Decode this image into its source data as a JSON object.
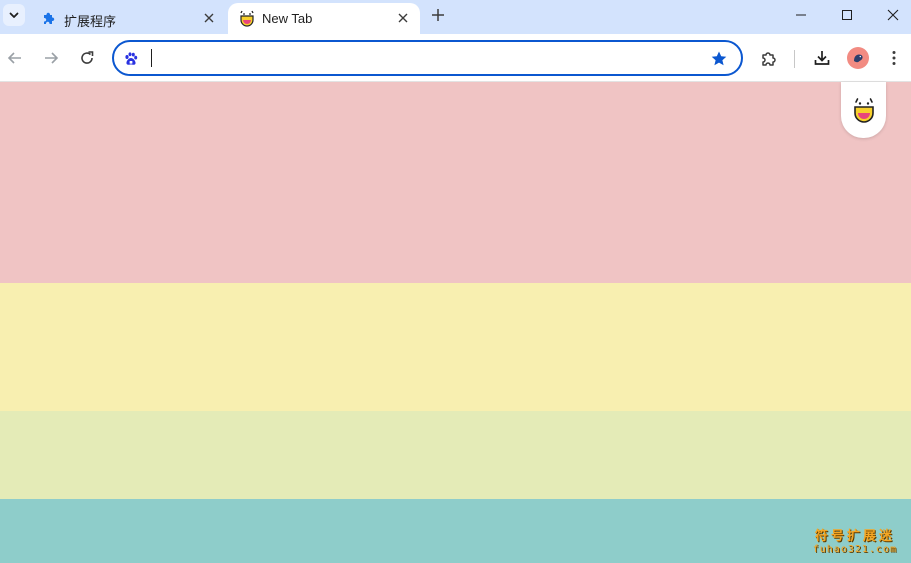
{
  "tabs": [
    {
      "label": "扩展程序",
      "icon": "puzzle-icon",
      "active": false
    },
    {
      "label": "New Tab",
      "icon": "smiley-logo-icon",
      "active": true
    }
  ],
  "toolbar": {
    "omnibox_value": "",
    "search_engine_icon": "baidu-paw-icon"
  },
  "page": {
    "bands": [
      {
        "color": "#f0c4c4"
      },
      {
        "color": "#f8efb0"
      },
      {
        "color": "#e4ebb7"
      },
      {
        "color": "#8ecdca"
      }
    ]
  },
  "watermark": {
    "line1": "符号扩展迷",
    "line2": "fuhao321.com"
  },
  "colors": {
    "accent": "#0b57d0",
    "tabstrip": "#d3e3fd"
  }
}
